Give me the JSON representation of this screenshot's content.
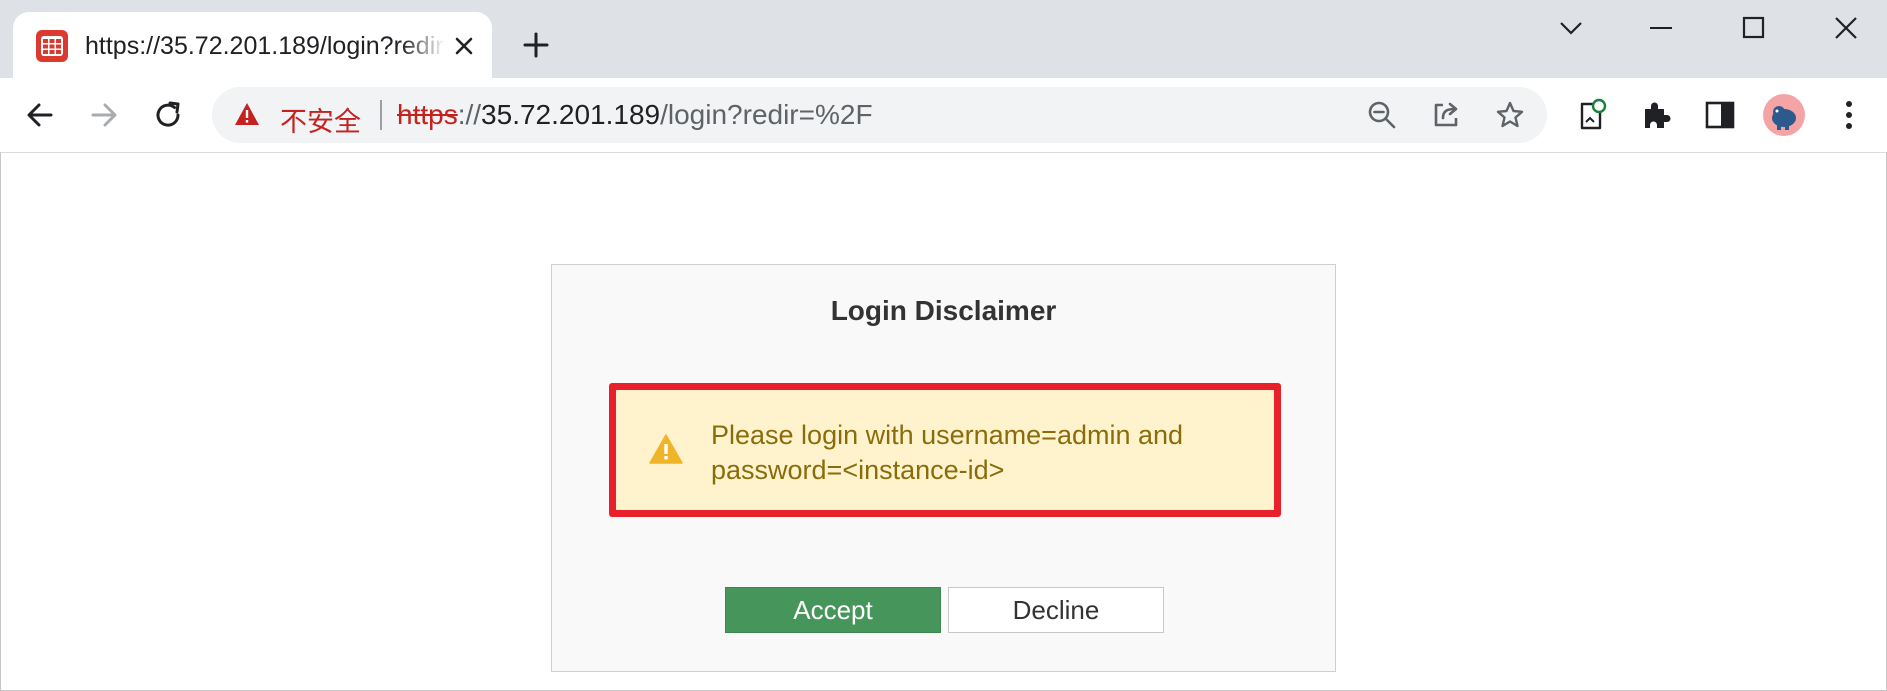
{
  "browser": {
    "tab": {
      "title": "https://35.72.201.189/login?redir=%2F"
    },
    "address_bar": {
      "security_label": "不安全",
      "url_scheme": "https",
      "url_separator": "://",
      "url_host": "35.72.201.189",
      "url_path": "/login?redir=%2F"
    },
    "icons": {
      "favicon": "fortinet-grid-icon",
      "tab_close": "close-icon",
      "new_tab": "plus-icon",
      "tab_search": "chevron-down-icon",
      "minimize": "minimize-icon",
      "maximize": "maximize-icon",
      "close_window": "close-icon",
      "back": "back-arrow-icon",
      "forward": "forward-arrow-icon",
      "reload": "reload-icon",
      "not_secure": "warning-triangle-icon",
      "zoom": "zoom-out-icon",
      "share": "share-icon",
      "bookmark": "star-icon",
      "extension_doc": "document-extension-icon",
      "extensions": "puzzle-icon",
      "side_panel": "side-panel-icon",
      "profile": "avatar",
      "menu": "kebab-menu-icon"
    },
    "colors": {
      "insecure": "#c5221f",
      "favicon": "#da3a2f"
    }
  },
  "dialog": {
    "title": "Login Disclaimer",
    "message": "Please login with username=admin and password=<instance-id>",
    "accept_label": "Accept",
    "decline_label": "Decline",
    "colors": {
      "accept": "#46955a",
      "highlight_border": "#e8202a",
      "message_bg": "#fff3cd",
      "message_text": "#8a6d0b"
    }
  }
}
